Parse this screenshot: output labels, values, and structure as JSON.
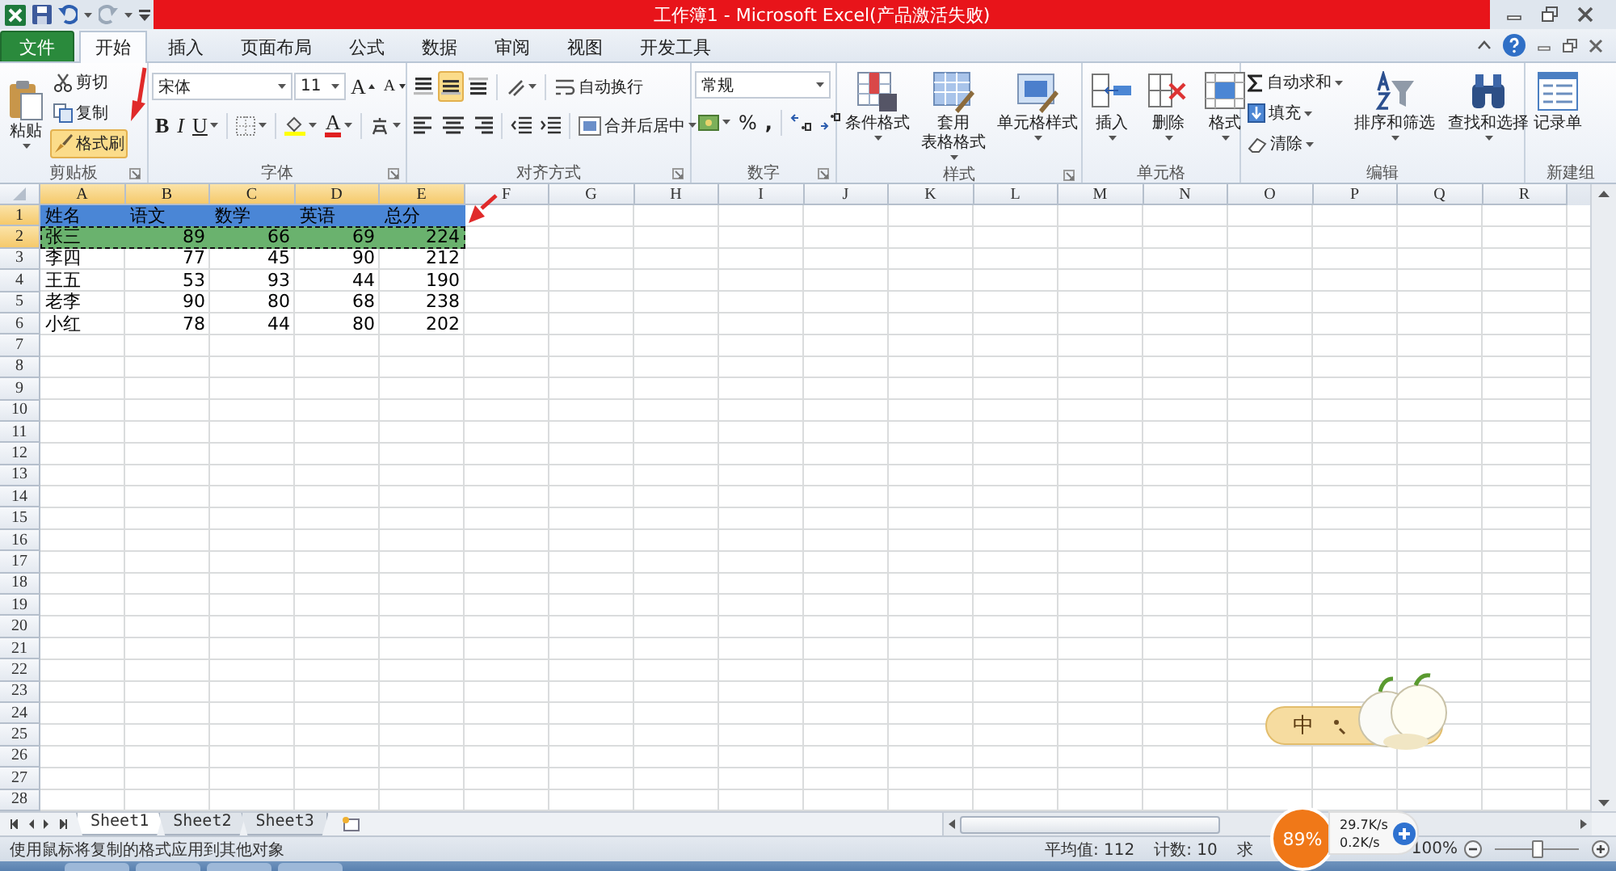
{
  "window": {
    "title": "工作簿1 - Microsoft Excel(产品激活失败)"
  },
  "ribbon_tabs": [
    {
      "label": "文件",
      "kind": "file",
      "selected": false
    },
    {
      "label": "开始",
      "kind": "tab",
      "selected": true
    },
    {
      "label": "插入",
      "kind": "tab",
      "selected": false
    },
    {
      "label": "页面布局",
      "kind": "tab",
      "selected": false
    },
    {
      "label": "公式",
      "kind": "tab",
      "selected": false
    },
    {
      "label": "数据",
      "kind": "tab",
      "selected": false
    },
    {
      "label": "审阅",
      "kind": "tab",
      "selected": false
    },
    {
      "label": "视图",
      "kind": "tab",
      "selected": false
    },
    {
      "label": "开发工具",
      "kind": "tab",
      "selected": false
    }
  ],
  "ribbon": [
    {
      "kind": "clipboard",
      "label": "剪贴板",
      "launcher": true,
      "controls": [
        {
          "label": "粘贴",
          "dropdown": true,
          "selected": false
        },
        {
          "label": "剪切",
          "dropdown": false,
          "selected": false
        },
        {
          "label": "复制",
          "dropdown": false,
          "selected": false
        },
        {
          "label": "格式刷",
          "dropdown": false,
          "selected": true
        }
      ]
    },
    {
      "kind": "font",
      "label": "字体",
      "launcher": true,
      "font": "宋体",
      "size": "11",
      "controls": [
        {
          "label": "A"
        },
        {
          "label": "A"
        },
        {
          "label": "B"
        },
        {
          "label": "I"
        },
        {
          "label": "U"
        },
        {
          "label": "A"
        }
      ]
    },
    {
      "kind": "alignment",
      "label": "对齐方式",
      "launcher": true,
      "vertical_align": [
        {
          "selected": false
        },
        {
          "selected": true
        },
        {
          "selected": false
        }
      ],
      "controls": [
        {
          "label": "自动换行",
          "dropdown": false
        },
        {
          "label": "合并后居中",
          "dropdown": true
        }
      ]
    },
    {
      "kind": "number",
      "label": "数字",
      "launcher": true,
      "format": "常规",
      "controls": [
        {
          "label": "%"
        },
        {
          "label": ","
        }
      ]
    },
    {
      "kind": "styles",
      "label": "样式",
      "launcher": true,
      "controls": [
        {
          "lines": [
            "条件格式"
          ],
          "dropdown": true
        },
        {
          "lines": [
            "套用",
            "表格格式"
          ],
          "dropdown": true
        },
        {
          "lines": [
            "单元格样式"
          ],
          "dropdown": true
        }
      ]
    },
    {
      "kind": "cells",
      "label": "单元格",
      "launcher": false,
      "controls": [
        {
          "lines": [
            "插入"
          ],
          "dropdown": true
        },
        {
          "lines": [
            "删除"
          ],
          "dropdown": true
        },
        {
          "lines": [
            "格式"
          ],
          "dropdown": true
        }
      ]
    },
    {
      "kind": "editing",
      "label": "编辑",
      "launcher": false,
      "controls": [
        {
          "lines": [
            "自动求和"
          ],
          "dropdown": true
        },
        {
          "lines": [
            "填充"
          ],
          "dropdown": true
        },
        {
          "lines": [
            "清除"
          ],
          "dropdown": true
        },
        {
          "lines": [
            "排序和筛选"
          ],
          "dropdown": true
        },
        {
          "lines": [
            "查找和选择"
          ],
          "dropdown": true
        }
      ]
    },
    {
      "kind": "custom",
      "label": "新建组",
      "launcher": false,
      "controls": [
        {
          "lines": [
            "记录单"
          ],
          "dropdown": false
        }
      ]
    }
  ],
  "sheet": {
    "columns": [
      {
        "label": "A",
        "selected": true
      },
      {
        "label": "B",
        "selected": true
      },
      {
        "label": "C",
        "selected": true
      },
      {
        "label": "D",
        "selected": true
      },
      {
        "label": "E",
        "selected": true
      },
      {
        "label": "F",
        "selected": false
      },
      {
        "label": "G",
        "selected": false
      },
      {
        "label": "H",
        "selected": false
      },
      {
        "label": "I",
        "selected": false
      },
      {
        "label": "J",
        "selected": false
      },
      {
        "label": "K",
        "selected": false
      },
      {
        "label": "L",
        "selected": false
      },
      {
        "label": "M",
        "selected": false
      },
      {
        "label": "N",
        "selected": false
      },
      {
        "label": "O",
        "selected": false
      },
      {
        "label": "P",
        "selected": false
      },
      {
        "label": "Q",
        "selected": false
      },
      {
        "label": "R",
        "selected": false
      }
    ],
    "row_headers": [
      {
        "label": "1",
        "selected": true
      },
      {
        "label": "2",
        "selected": true
      },
      {
        "label": "3",
        "selected": false
      },
      {
        "label": "4",
        "selected": false
      },
      {
        "label": "5",
        "selected": false
      },
      {
        "label": "6",
        "selected": false
      },
      {
        "label": "7",
        "selected": false
      },
      {
        "label": "8",
        "selected": false
      },
      {
        "label": "9",
        "selected": false
      },
      {
        "label": "10",
        "selected": false
      },
      {
        "label": "11",
        "selected": false
      },
      {
        "label": "12",
        "selected": false
      },
      {
        "label": "13",
        "selected": false
      },
      {
        "label": "14",
        "selected": false
      },
      {
        "label": "15",
        "selected": false
      },
      {
        "label": "16",
        "selected": false
      },
      {
        "label": "17",
        "selected": false
      },
      {
        "label": "18",
        "selected": false
      },
      {
        "label": "19",
        "selected": false
      },
      {
        "label": "20",
        "selected": false
      },
      {
        "label": "21",
        "selected": false
      },
      {
        "label": "22",
        "selected": false
      },
      {
        "label": "23",
        "selected": false
      },
      {
        "label": "24",
        "selected": false
      },
      {
        "label": "25",
        "selected": false
      },
      {
        "label": "26",
        "selected": false
      },
      {
        "label": "27",
        "selected": false
      },
      {
        "label": "28",
        "selected": false
      }
    ],
    "rows": [
      {
        "kind": "header",
        "color": "#4a86d6",
        "copied": false,
        "cells": [
          "姓名",
          "语文",
          "数学",
          "英语",
          "总分"
        ]
      },
      {
        "kind": "data",
        "color": "#6ab26e",
        "copied": true,
        "cells": [
          "张三",
          "89",
          "66",
          "69",
          "224"
        ]
      },
      {
        "kind": "data",
        "copied": false,
        "cells": [
          "李四",
          "77",
          "45",
          "90",
          "212"
        ]
      },
      {
        "kind": "data",
        "copied": false,
        "cells": [
          "王五",
          "53",
          "93",
          "44",
          "190"
        ]
      },
      {
        "kind": "data",
        "copied": false,
        "cells": [
          "老李",
          "90",
          "80",
          "68",
          "238"
        ]
      },
      {
        "kind": "data",
        "copied": false,
        "cells": [
          "小红",
          "78",
          "44",
          "80",
          "202"
        ]
      }
    ]
  },
  "sheet_tabs": [
    {
      "label": "Sheet1",
      "selected": true
    },
    {
      "label": "Sheet2",
      "selected": false
    },
    {
      "label": "Sheet3",
      "selected": false
    }
  ],
  "status_bar": {
    "message": "使用鼠标将复制的格式应用到其他对象",
    "items": [
      "平均值: 112",
      "计数: 10",
      "求"
    ],
    "zoom": "100%",
    "zoom_slider": {
      "level": 0.5
    }
  },
  "ime": {
    "label": "中"
  },
  "net_monitor": {
    "percent": "89%",
    "upload": "29.7K/s",
    "download": "0.2K/s"
  }
}
